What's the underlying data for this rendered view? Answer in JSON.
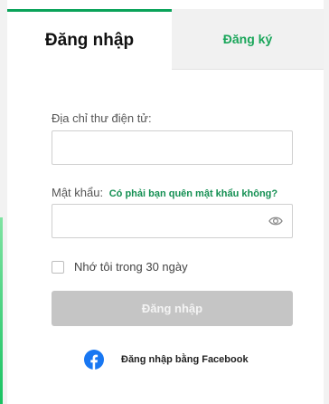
{
  "tabs": {
    "login": "Đăng nhập",
    "register": "Đăng ký"
  },
  "form": {
    "email_label": "Địa chỉ thư điện tử:",
    "email_value": "",
    "password_label": "Mật khẩu:",
    "forgot_link": "Có phải bạn quên mật khẩu không?",
    "password_value": "",
    "remember_label": "Nhớ tôi trong 30 ngày",
    "remember_checked": false,
    "submit_label": "Đăng nhập"
  },
  "facebook": {
    "label": "Đăng nhập bằng Facebook",
    "icon": "facebook-icon"
  },
  "colors": {
    "accent": "#0aa35a",
    "facebook": "#1877f2",
    "disabled_button": "#c5c5c5"
  }
}
